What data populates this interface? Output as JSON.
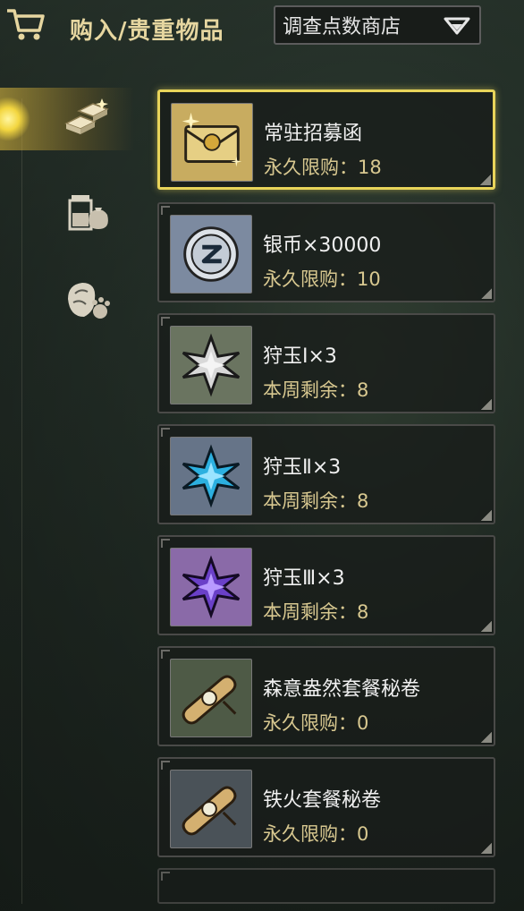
{
  "header": {
    "title": "购入/贵重物品",
    "cart_icon": "cart-icon",
    "shop_select": {
      "value": "调查点数商店",
      "icon": "chevron-down-icon"
    }
  },
  "categories": [
    {
      "name": "materials",
      "icon": "gold-bars-icon",
      "active": true
    },
    {
      "name": "consumables",
      "icon": "potion-bag-icon",
      "active": false
    },
    {
      "name": "monster-parts",
      "icon": "monster-paw-icon",
      "active": false
    }
  ],
  "items": [
    {
      "name": "常驻招募函",
      "limit": "永久限购：18",
      "icon": "gold-envelope-icon",
      "bg": "#c8ac60",
      "selected": true
    },
    {
      "name": "银币×30000",
      "limit": "永久限购：10",
      "icon": "silver-coin-icon",
      "bg": "#7c8aa0",
      "selected": false
    },
    {
      "name": "狩玉Ⅰ×3",
      "limit": "本周剩余：8",
      "icon": "white-gem-icon",
      "bg": "#6a7460",
      "selected": false
    },
    {
      "name": "狩玉Ⅱ×3",
      "limit": "本周剩余：8",
      "icon": "blue-gem-icon",
      "bg": "#667488",
      "selected": false
    },
    {
      "name": "狩玉Ⅲ×3",
      "limit": "本周剩余：8",
      "icon": "purple-gem-icon",
      "bg": "#8a6aa8",
      "selected": false
    },
    {
      "name": "森意盎然套餐秘卷",
      "limit": "永久限购：0",
      "icon": "scroll-icon",
      "bg": "#4e5a46",
      "selected": false
    },
    {
      "name": "铁火套餐秘卷",
      "limit": "永久限购：0",
      "icon": "scroll-icon",
      "bg": "#4a5258",
      "selected": false
    }
  ],
  "colors": {
    "gold_accent": "#e8d45a",
    "limit_text": "#d8c890"
  }
}
